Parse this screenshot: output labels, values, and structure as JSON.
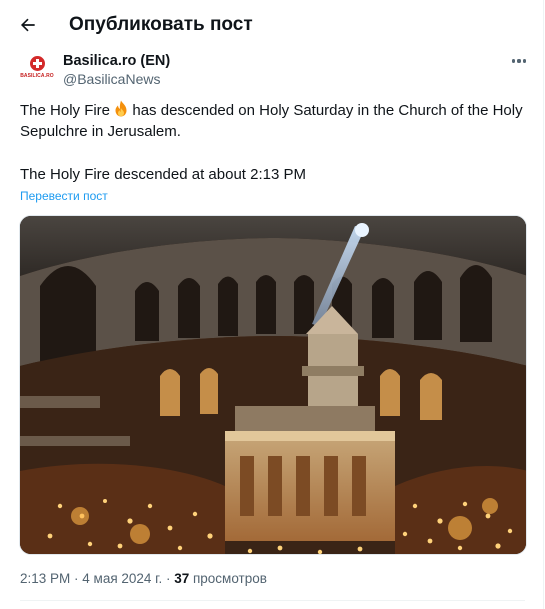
{
  "header": {
    "title": "Опубликовать пост",
    "back_icon": "arrow-left-icon"
  },
  "author": {
    "name": "Basilica.ro (EN)",
    "handle": "@BasilicaNews",
    "avatar_text": "BASILICA.RO",
    "avatar_color": "#d32a2a"
  },
  "post": {
    "line1_before": "The Holy Fire ",
    "emoji_icon": "fire-icon",
    "line1_after": " has descended on Holy Saturday in the Church of the Holy Sepulchre in Jerusalem.",
    "line2": "The Holy Fire descended at about 2:13 PM",
    "translate_label": "Перевести пост",
    "image_alt": "Crowd holding candles around the Aedicule inside the rotunda of the Church of the Holy Sepulchre"
  },
  "meta": {
    "time": "2:13 PM",
    "separator": " · ",
    "date": "4 мая 2024 г.",
    "views_count": "37",
    "views_label": " просмотров"
  },
  "colors": {
    "link": "#1d9bf0",
    "secondary_text": "#536471",
    "primary_text": "#0f1419"
  }
}
